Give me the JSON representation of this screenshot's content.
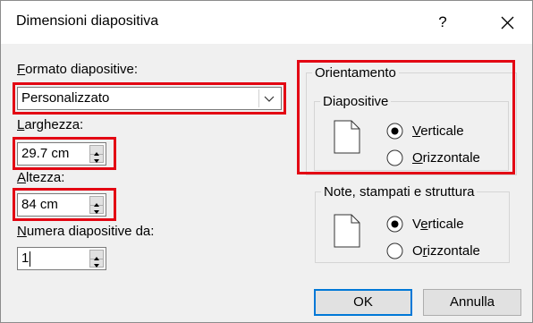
{
  "dialog": {
    "title": "Dimensioni diapositiva",
    "help_label": "?",
    "close_icon": "close-icon"
  },
  "format": {
    "label_accel": "F",
    "label_rest": "ormato diapositive:",
    "value": "Personalizzato"
  },
  "width": {
    "label_accel": "L",
    "label_rest": "arghezza:",
    "value": "29.7 cm"
  },
  "height": {
    "label_accel": "A",
    "label_rest": "ltezza:",
    "value": "84 cm"
  },
  "numbering": {
    "label_accel": "N",
    "label_rest": "umera diapositive da:",
    "value": "1"
  },
  "orientation": {
    "group_label": "Orientamento",
    "slides_label": "Diapositive",
    "portrait_accel": "V",
    "portrait_rest": "erticale",
    "landscape_accel": "O",
    "landscape_rest": "rizzontale",
    "selected": "portrait"
  },
  "notes": {
    "group_label": "Note, stampati e struttura",
    "portrait_pre": "V",
    "portrait_accel": "e",
    "portrait_rest": "rticale",
    "landscape_pre": "O",
    "landscape_accel": "r",
    "landscape_rest": "izzontale",
    "selected": "portrait"
  },
  "buttons": {
    "ok": "OK",
    "cancel": "Annulla"
  },
  "colors": {
    "highlight": "#e30613",
    "accent": "#0078d7"
  }
}
